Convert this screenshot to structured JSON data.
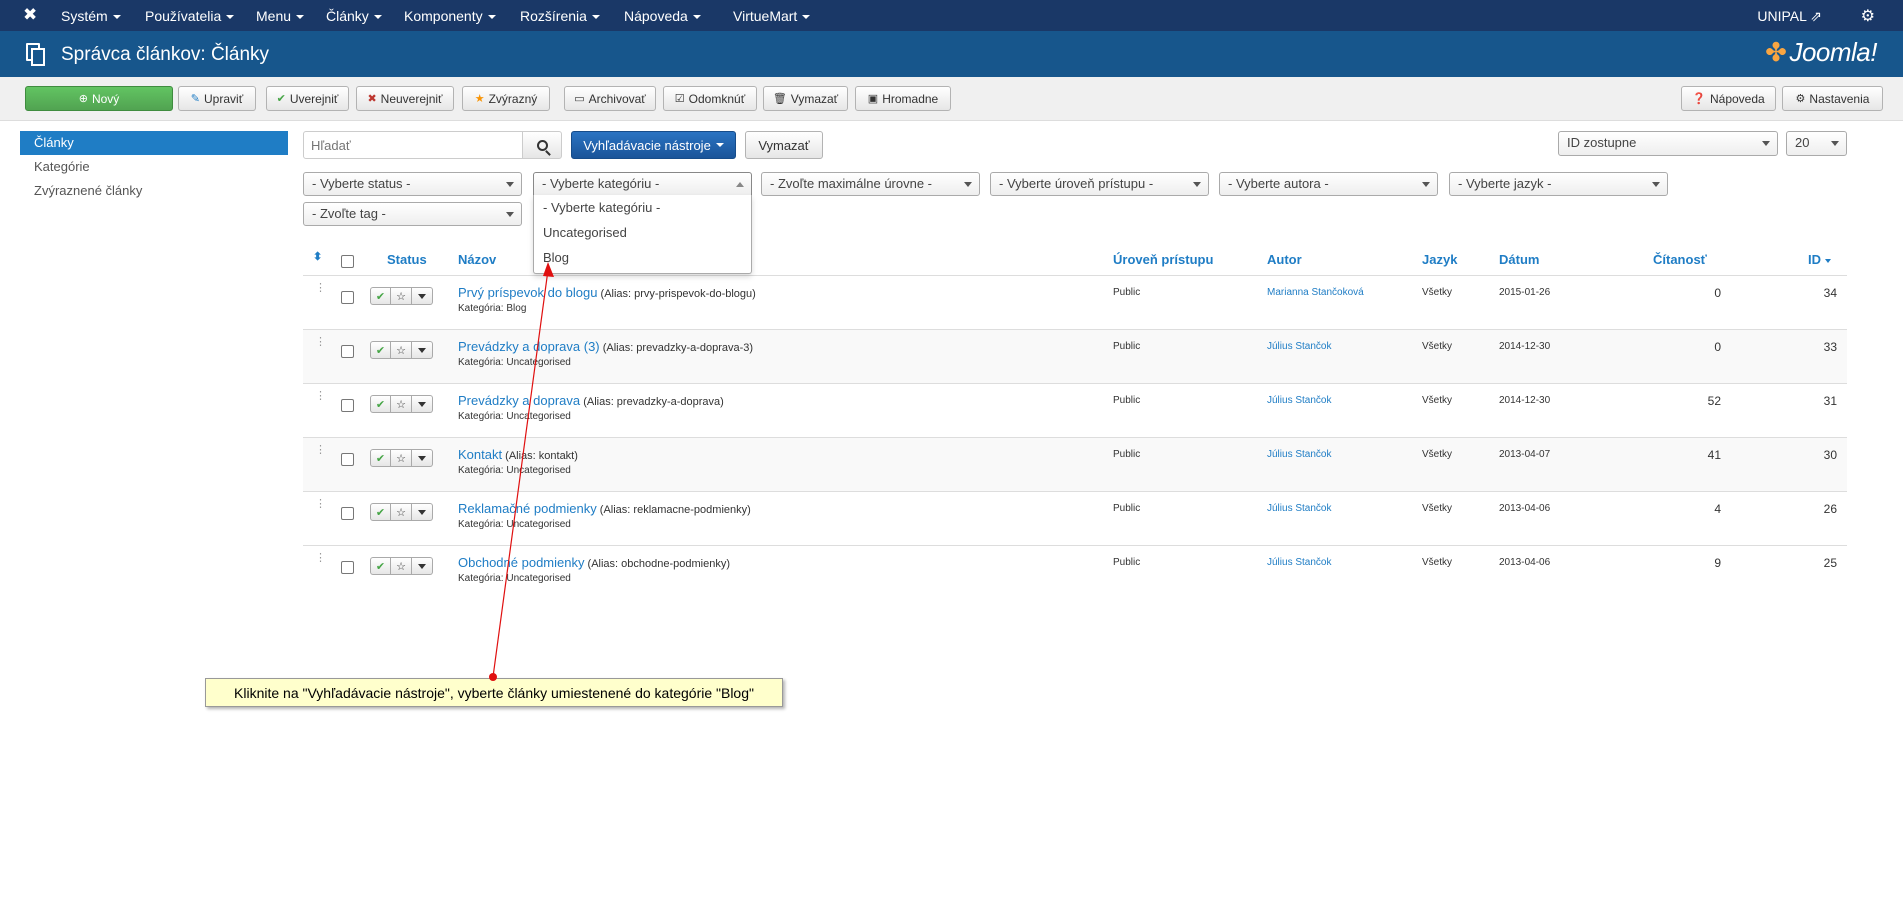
{
  "topnav": {
    "logo": "✖",
    "menu": [
      {
        "label": "Systém"
      },
      {
        "label": "Používatelia"
      },
      {
        "label": "Menu"
      },
      {
        "label": "Články"
      },
      {
        "label": "Komponenty"
      },
      {
        "label": "Rozšírenia"
      },
      {
        "label": "Nápoveda"
      },
      {
        "label": "VirtueMart"
      }
    ],
    "user": "UNIPAL ⇗",
    "gear": "⚙"
  },
  "header": {
    "title": "Správca článkov: Články",
    "brand": "Joomla!",
    "brand_mark": "✤"
  },
  "toolbar": {
    "new": "Nový",
    "edit": "Upraviť",
    "publish": "Uverejniť",
    "unpublish": "Neuverejniť",
    "feature": "Zvýrazný",
    "archive": "Archivovať",
    "checkin": "Odomknúť",
    "trash": "Vymazať",
    "batch": "Hromadne",
    "help": "Nápoveda",
    "options": "Nastavenia"
  },
  "sidebar": {
    "items": [
      {
        "label": "Články",
        "active": true
      },
      {
        "label": "Kategórie"
      },
      {
        "label": "Zvýraznené články"
      }
    ]
  },
  "search": {
    "placeholder": "Hľadať",
    "tools_label": "Vyhľadávacie nástroje",
    "clear_label": "Vymazať"
  },
  "ordering": {
    "value": "ID zostupne"
  },
  "limit": {
    "value": "20"
  },
  "filters": {
    "status": "- Vyberte status -",
    "category": "- Vyberte kategóriu -",
    "level": "- Zvoľte maximálne úrovne -",
    "access": "- Vyberte úroveň prístupu -",
    "author": "- Vyberte autora -",
    "language": "- Vyberte jazyk -",
    "tag": "- Zvoľte tag -"
  },
  "category_options": [
    "- Vyberte kategóriu -",
    "Uncategorised",
    "Blog"
  ],
  "columns": {
    "status": "Status",
    "title": "Názov",
    "access": "Úroveň prístupu",
    "author": "Autor",
    "language": "Jazyk",
    "date": "Dátum",
    "hits": "Čítanosť",
    "id": "ID"
  },
  "rows": [
    {
      "title": "Prvý príspevok do blogu",
      "alias": "(Alias: prvy-prispevok-do-blogu)",
      "category": "Kategória: Blog",
      "access": "Public",
      "author": "Marianna Stančoková",
      "language": "Všetky",
      "date": "2015-01-26",
      "hits": "0",
      "id": "34"
    },
    {
      "title": "Prevádzky a doprava (3)",
      "alias": "(Alias: prevadzky-a-doprava-3)",
      "category": "Kategória: Uncategorised",
      "access": "Public",
      "author": "Július Stančok",
      "language": "Všetky",
      "date": "2014-12-30",
      "hits": "0",
      "id": "33"
    },
    {
      "title": "Prevádzky a doprava",
      "alias": "(Alias: prevadzky-a-doprava)",
      "category": "Kategória: Uncategorised",
      "access": "Public",
      "author": "Július Stančok",
      "language": "Všetky",
      "date": "2014-12-30",
      "hits": "52",
      "id": "31"
    },
    {
      "title": "Kontakt",
      "alias": "(Alias: kontakt)",
      "category": "Kategória: Uncategorised",
      "access": "Public",
      "author": "Július Stančok",
      "language": "Všetky",
      "date": "2013-04-07",
      "hits": "41",
      "id": "30"
    },
    {
      "title": "Reklamačné podmienky",
      "alias": "(Alias: reklamacne-podmienky)",
      "category": "Kategória: Uncategorised",
      "access": "Public",
      "author": "Július Stančok",
      "language": "Všetky",
      "date": "2013-04-06",
      "hits": "4",
      "id": "26"
    },
    {
      "title": "Obchodné podmienky",
      "alias": "(Alias: obchodne-podmienky)",
      "category": "Kategória: Uncategorised",
      "access": "Public",
      "author": "Július Stančok",
      "language": "Všetky",
      "date": "2013-04-06",
      "hits": "9",
      "id": "25"
    }
  ],
  "callout": {
    "text": "Kliknite na \"Vyhľadávacie nástroje\", vyberte  články umiestenené do kategórie \"Blog\""
  },
  "colors": {
    "nav": "#1a3867",
    "header": "#17568c",
    "accent": "#1f7dc5",
    "annotation": "#e01010"
  }
}
